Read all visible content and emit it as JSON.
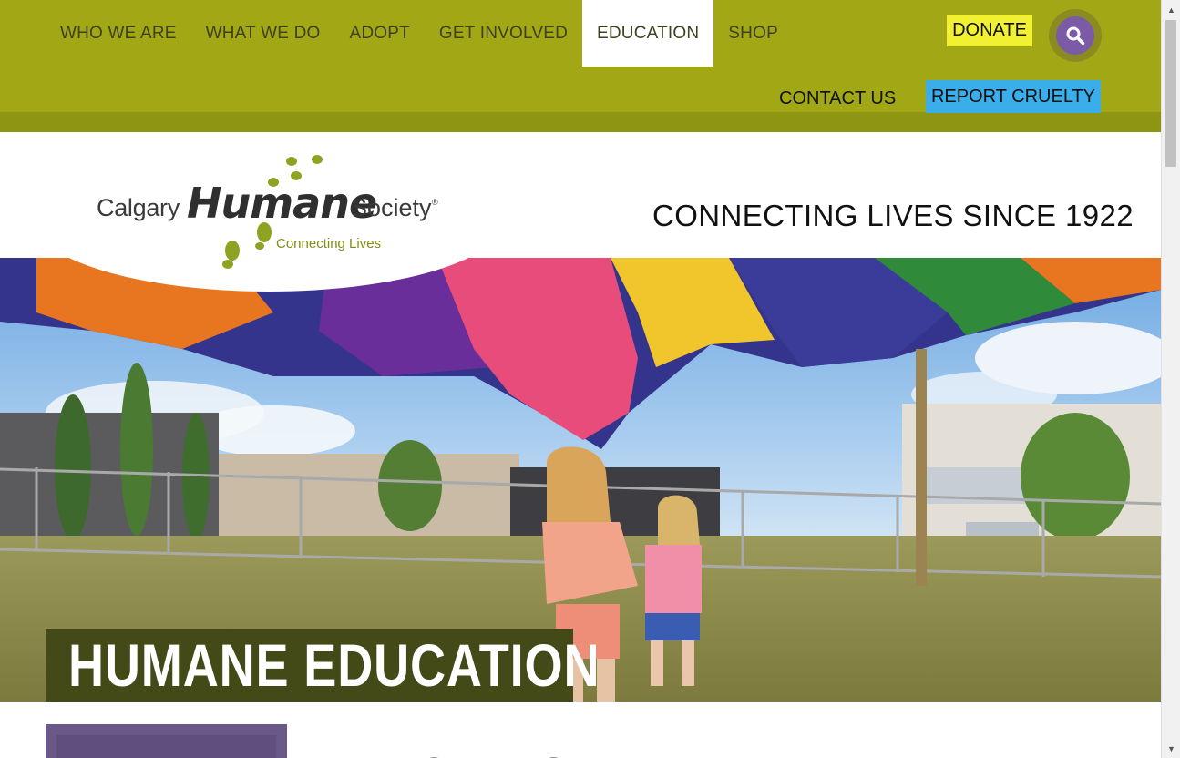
{
  "nav": {
    "items": [
      {
        "label": "WHO WE ARE",
        "active": false
      },
      {
        "label": "WHAT WE DO",
        "active": false
      },
      {
        "label": "ADOPT",
        "active": false
      },
      {
        "label": "GET INVOLVED",
        "active": false
      },
      {
        "label": "EDUCATION",
        "active": true
      },
      {
        "label": "SHOP",
        "active": false
      }
    ],
    "donate_label": "DONATE",
    "contact_label": "CONTACT US",
    "report_label": "REPORT CRUELTY",
    "search_icon": "search-icon"
  },
  "header": {
    "logo": {
      "word1": "Calgary",
      "word2": "Humane",
      "word3": "Society",
      "registered": "®",
      "slogan": "Connecting Lives"
    },
    "tagline": "CONNECTING LIVES SINCE 1922"
  },
  "hero": {
    "title": "HUMANE EDUCATION"
  },
  "content": {
    "section_heading": "DAY CAMPS"
  },
  "colors": {
    "topbar": "#a2a815",
    "donate": "#f2f032",
    "report": "#3aaeea",
    "search": "#7b5aa6",
    "hero_title_bg": "#434a17",
    "card_purple": "#6a5888"
  }
}
